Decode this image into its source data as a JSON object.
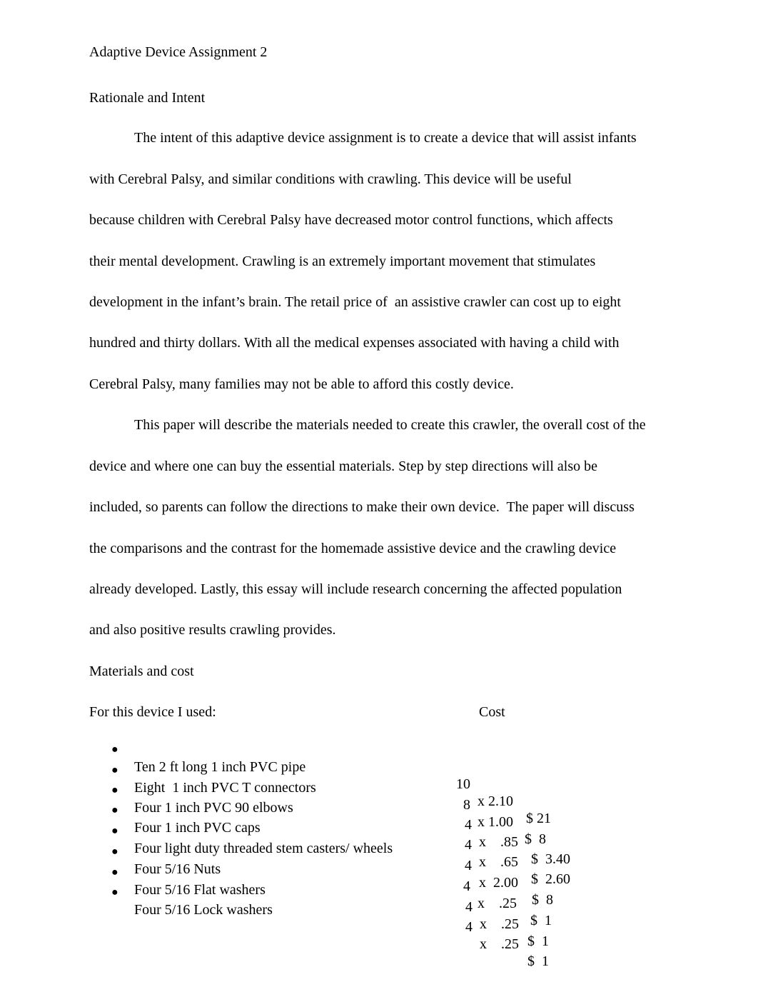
{
  "header": {
    "title": "Adaptive Device Assignment 2"
  },
  "sections": {
    "rationale": {
      "heading": "Rationale and Intent",
      "paragraph1": [
        "The intent of this adaptive device assignment is to create a device that will assist infants",
        "with Cerebral Palsy, and similar conditions with crawling. This device will be useful",
        "because children with Cerebral Palsy have decreased motor control functions, which affects",
        "their mental development. Crawling is an extremely important movement that stimulates",
        "development in the infant’s brain. The retail price of  an assistive crawler can cost up to eight",
        "hundred and thirty dollars. With all the medical expenses associated with having a child with",
        "Cerebral Palsy, many families may not be able to afford this costly device."
      ],
      "paragraph2": [
        "This paper will describe the materials needed to create this crawler, the overall cost of the",
        "device and where one can buy the essential materials. Step by step directions will also be",
        "included, so parents can follow the directions to make their own device.  The paper will discuss",
        "the comparisons and the contrast for the homemade assistive device and the crawling device",
        "already developed. Lastly, this essay will include research concerning the affected population",
        "and also positive results crawling provides."
      ]
    },
    "materials": {
      "heading": "Materials and cost",
      "intro": "For this device I used:",
      "cost_header": "Cost",
      "bullet_glyph": "●",
      "items": [
        {
          "name": "Ten 2 ft long 1 inch PVC pipe",
          "qty": "10",
          "unit": "x 2.10",
          "total": "$ 21"
        },
        {
          "name": "Eight  1 inch PVC T connectors",
          "qty": "8",
          "unit": "x 1.00",
          "total": "$  8"
        },
        {
          "name": "Four 1 inch PVC 90 elbows",
          "qty": "4",
          "unit": "x    .85",
          "total": "$  3.40"
        },
        {
          "name": "Four 1 inch PVC caps",
          "qty": "4",
          "unit": "x    .65",
          "total": "$  2.60"
        },
        {
          "name": "Four light duty threaded stem casters/ wheels",
          "qty": "4",
          "unit": "x  2.00",
          "total": "$  8"
        },
        {
          "name": "Four 5/16 Nuts",
          "qty": "4",
          "unit": "x    .25",
          "total": "$  1"
        },
        {
          "name": "Four 5/16 Flat washers",
          "qty": "4",
          "unit": "x    .25",
          "total": "$  1"
        },
        {
          "name": "Four 5/16 Lock washers",
          "qty": "4",
          "unit": "x    .25",
          "total": "$  1"
        }
      ]
    }
  }
}
